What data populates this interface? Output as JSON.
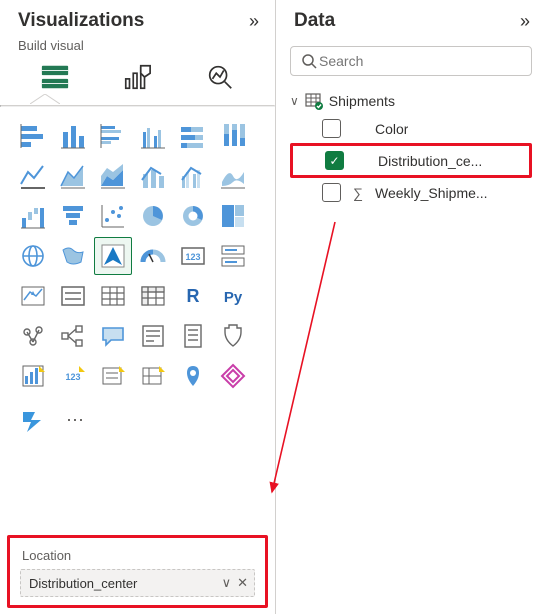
{
  "viz": {
    "title": "Visualizations",
    "subtitle": "Build visual",
    "tabs": [
      "build",
      "format",
      "analytics"
    ],
    "icons": [
      "stacked-bar-horizontal",
      "stacked-bar-vertical",
      "clustered-bar-horizontal",
      "clustered-bar-vertical",
      "100-stacked-bar-h",
      "100-stacked-bar-v",
      "line-chart",
      "area-chart",
      "stacked-area",
      "line-stacked-column",
      "line-clustered-column",
      "ribbon-chart",
      "waterfall",
      "funnel",
      "scatter",
      "pie",
      "donut",
      "treemap",
      "map",
      "filled-map",
      "azure-map",
      "gauge",
      "card",
      "multi-row-card",
      "kpi",
      "slicer",
      "table",
      "matrix",
      "r-visual",
      "python-visual",
      "key-influencers",
      "decomposition-tree",
      "qna",
      "smart-narrative",
      "paginated",
      "power-apps",
      "power-automate",
      "more-visuals"
    ],
    "selected_visual": "azure-map",
    "field_well": {
      "label": "Location",
      "field": "Distribution_center"
    }
  },
  "data": {
    "title": "Data",
    "search_placeholder": "Search",
    "table": {
      "name": "Shipments",
      "expanded": true,
      "fields": [
        {
          "name": "Color",
          "checked": false,
          "aggregate": false
        },
        {
          "name": "Distribution_ce...",
          "checked": true,
          "aggregate": false
        },
        {
          "name": "Weekly_Shipme...",
          "checked": false,
          "aggregate": true
        }
      ]
    }
  }
}
